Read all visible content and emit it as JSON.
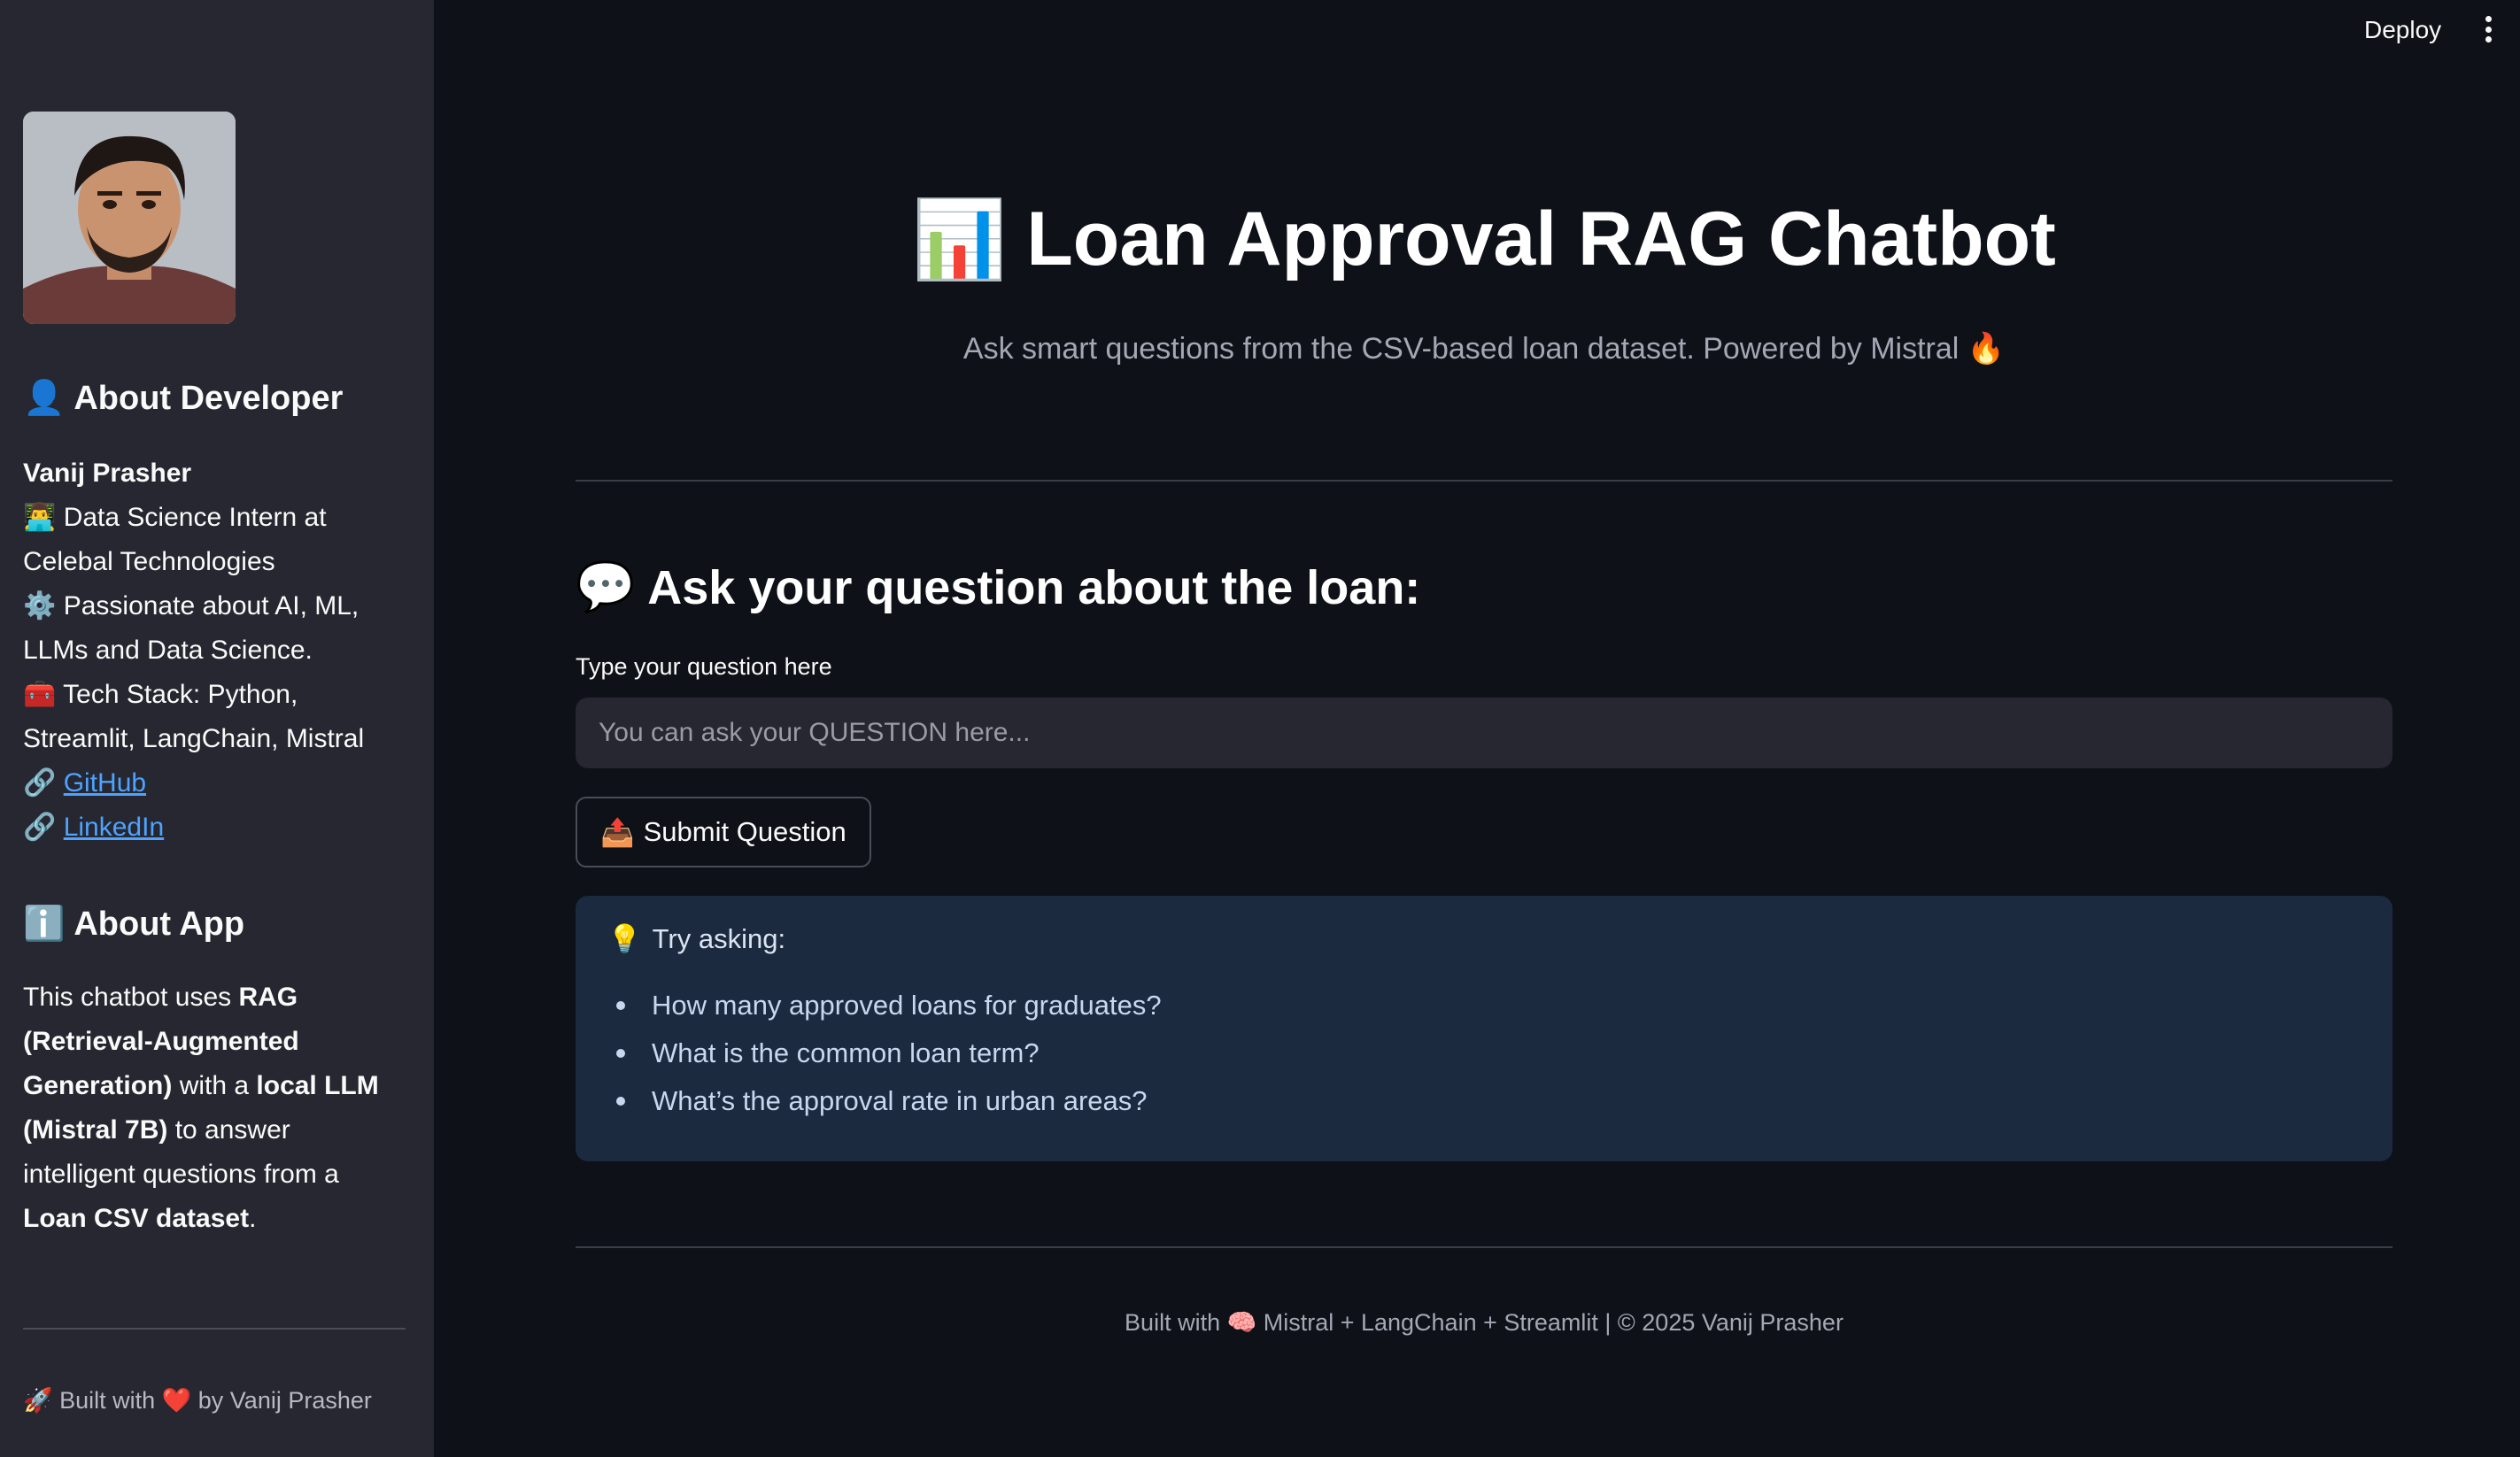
{
  "header": {
    "deploy_label": "Deploy",
    "menu_icon": "more-vertical-icon"
  },
  "sidebar": {
    "about_dev_heading": "About Developer",
    "about_dev_emoji": "👤",
    "dev_name": "Vanij Prasher",
    "lines": [
      {
        "emoji": "👨‍💻",
        "text": "Data Science Intern at Celebal Technologies"
      },
      {
        "emoji": "⚙️",
        "text": "Passionate about AI, ML, LLMs and Data Science."
      },
      {
        "emoji": "🧰",
        "text": "Tech Stack: Python, Streamlit, LangChain, Mistral"
      }
    ],
    "links": [
      {
        "emoji": "🔗",
        "label": "GitHub"
      },
      {
        "emoji": "🔗",
        "label": "LinkedIn"
      }
    ],
    "about_app_heading": "About App",
    "about_app_emoji": "ℹ️",
    "about_app_parts": {
      "p1": "This chatbot uses ",
      "b1": "RAG (Retrieval-Augmented Generation)",
      "p2": " with a ",
      "b2": "local LLM (Mistral 7B)",
      "p3": " to answer intelligent questions from a ",
      "b3": "Loan CSV dataset",
      "p4": "."
    },
    "footer": "🚀 Built with ❤️ by Vanij Prasher"
  },
  "main": {
    "title_emoji": "📊",
    "title": "Loan Approval RAG Chatbot",
    "subtitle": "Ask smart questions from the CSV-based loan dataset. Powered by Mistral 🔥",
    "question_heading_emoji": "💬",
    "question_heading": "Ask your question about the loan:",
    "input_label": "Type your question here",
    "input_placeholder": "You can ask your QUESTION here...",
    "input_value": "",
    "submit_emoji": "📤",
    "submit_label": "Submit Question",
    "tip_emoji": "💡",
    "tip_title": "Try asking:",
    "tips": [
      "How many approved loans for graduates?",
      "What is the common loan term?",
      "What’s the approval rate in urban areas?"
    ],
    "footer": "Built with 🧠 Mistral + LangChain + Streamlit | © 2025 Vanij Prasher"
  }
}
